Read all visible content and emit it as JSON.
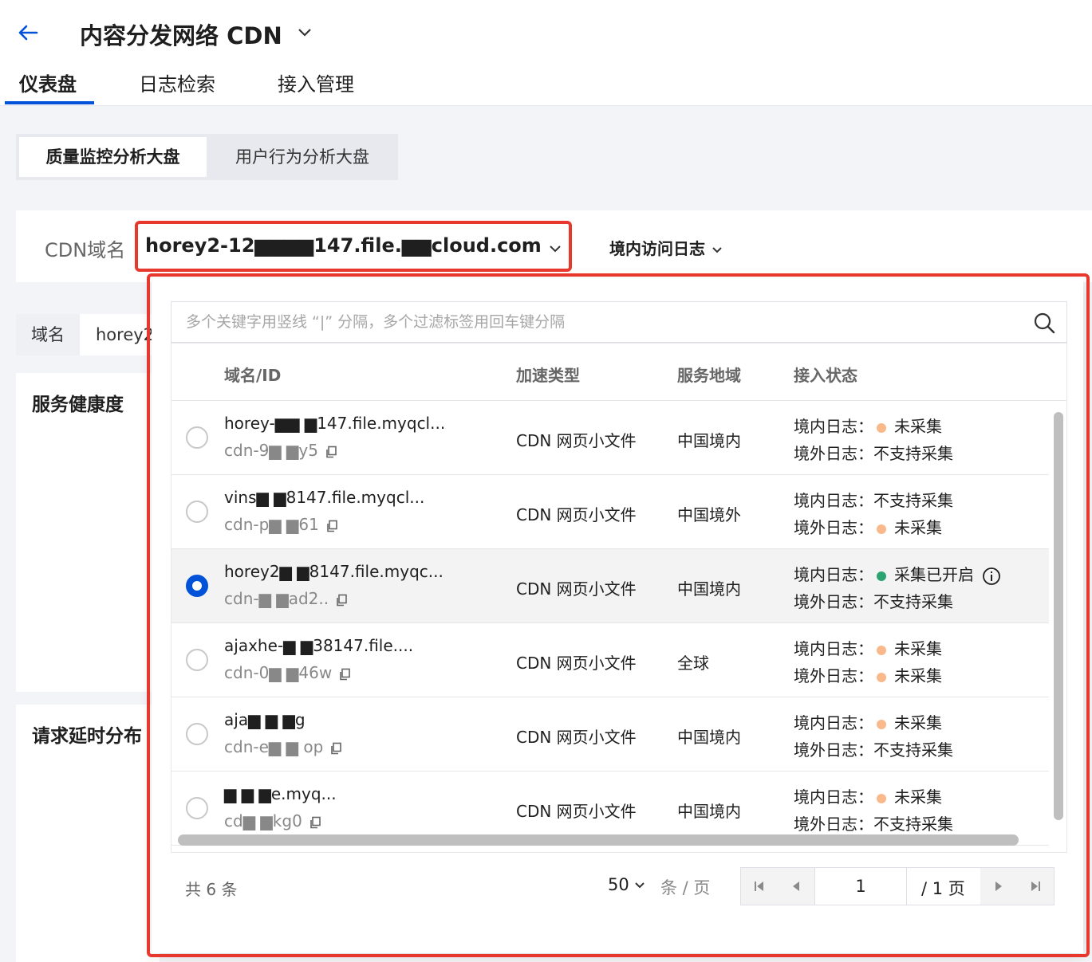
{
  "header": {
    "title": "内容分发网络 CDN",
    "tabs": [
      {
        "label": "仪表盘",
        "active": true
      },
      {
        "label": "日志检索",
        "active": false
      },
      {
        "label": "接入管理",
        "active": false
      }
    ]
  },
  "dashboard_tabs": [
    {
      "label": "质量监控分析大盘",
      "active": true
    },
    {
      "label": "用户行为分析大盘",
      "active": false
    }
  ],
  "filter": {
    "cdn_label": "CDN域名",
    "selected_domain": "horey2-12▆▆▆▆147.file.▆▆cloud.com",
    "log_type": "境内访问日志"
  },
  "domain_filter": {
    "label": "域名",
    "value": "horey2"
  },
  "cards": {
    "health_title": "服务健康度",
    "latency_title": "请求延时分布"
  },
  "dropdown": {
    "search_placeholder": "多个关键字用竖线 “|” 分隔，多个过滤标签用回车键分隔",
    "columns": {
      "name": "域名/ID",
      "type": "加速类型",
      "region": "服务地域",
      "status": "接入状态"
    },
    "rows": [
      {
        "name": "horey-▆▆ ▆147.file.myqcl...",
        "id": "cdn-9▆ ▆y5",
        "type": "CDN 网页小文件",
        "region": "中国境内",
        "domestic_label": "境内日志：",
        "domestic_status": "未采集",
        "domestic_dot": "#f9b98a",
        "overseas_label": "境外日志：",
        "overseas_status": "不支持采集",
        "overseas_dot": "",
        "selected": false,
        "info": false
      },
      {
        "name": "vins▆ ▆8147.file.myqcl...",
        "id": "cdn-p▆ ▆61",
        "type": "CDN 网页小文件",
        "region": "中国境外",
        "domestic_label": "境内日志：",
        "domestic_status": "不支持采集",
        "domestic_dot": "",
        "overseas_label": "境外日志：",
        "overseas_status": "未采集",
        "overseas_dot": "#f9b98a",
        "selected": false,
        "info": false
      },
      {
        "name": "horey2▆ ▆8147.file.myqc...",
        "id": "cdn-▆ ▆ad2..",
        "type": "CDN 网页小文件",
        "region": "中国境内",
        "domestic_label": "境内日志：",
        "domestic_status": "采集已开启",
        "domestic_dot": "#2ba471",
        "overseas_label": "境外日志：",
        "overseas_status": "不支持采集",
        "overseas_dot": "",
        "selected": true,
        "info": true
      },
      {
        "name": "ajaxhe-▆ ▆38147.file....",
        "id": "cdn-0▆ ▆46w",
        "type": "CDN 网页小文件",
        "region": "全球",
        "domestic_label": "境内日志：",
        "domestic_status": "未采集",
        "domestic_dot": "#f9b98a",
        "overseas_label": "境外日志：",
        "overseas_status": "未采集",
        "overseas_dot": "#f9b98a",
        "selected": false,
        "info": false
      },
      {
        "name": "aja▆ ▆ ▆g",
        "id": "cdn-e▆ ▆ op",
        "type": "CDN 网页小文件",
        "region": "中国境内",
        "domestic_label": "境内日志：",
        "domestic_status": "未采集",
        "domestic_dot": "#f9b98a",
        "overseas_label": "境外日志：",
        "overseas_status": "不支持采集",
        "overseas_dot": "",
        "selected": false,
        "info": false
      },
      {
        "name": "▆ ▆ ▆e.myq...",
        "id": "cd▆ ▆kg0",
        "type": "CDN 网页小文件",
        "region": "中国境内",
        "domestic_label": "境内日志：",
        "domestic_status": "未采集",
        "domestic_dot": "#f9b98a",
        "overseas_label": "境外日志：",
        "overseas_status": "不支持采集",
        "overseas_dot": "",
        "selected": false,
        "info": false
      }
    ],
    "pagination": {
      "total": "共 6 条",
      "page_size": "50",
      "page_size_unit": "条 / 页",
      "current_page": "1",
      "total_pages": "/ 1 页"
    }
  },
  "colors": {
    "accent": "#0052d9",
    "highlight": "#e8372c",
    "pending": "#f9b98a",
    "enabled": "#2ba471"
  }
}
